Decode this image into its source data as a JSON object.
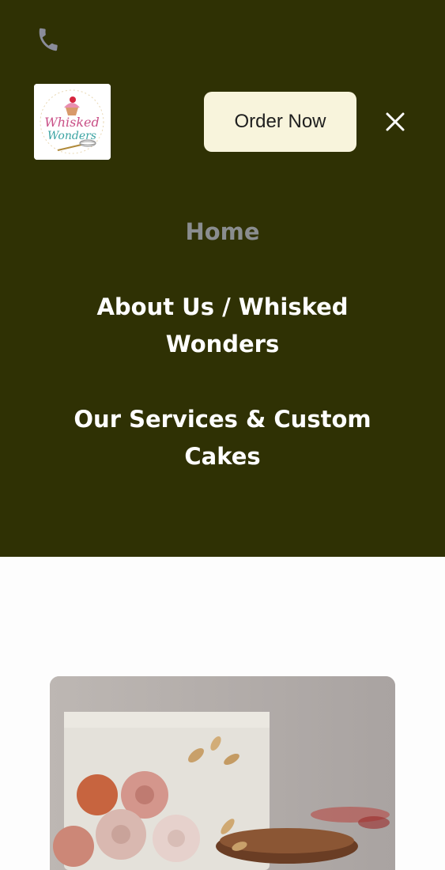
{
  "header": {
    "phone_icon": "phone-icon",
    "logo": {
      "line1": "Whisked",
      "line2": "Wonders"
    },
    "order_button_label": "Order Now",
    "close_icon": "close-icon"
  },
  "nav": {
    "items": [
      {
        "label": "Home",
        "active": true
      },
      {
        "label": "About Us / Whisked Wonders",
        "active": false
      },
      {
        "label": "Our Services & Custom Cakes",
        "active": false
      }
    ]
  },
  "colors": {
    "menu_background": "#2f3104",
    "order_button_bg": "#f8f4dc",
    "active_nav": "#8a8d8f",
    "nav_text": "#ffffff"
  },
  "hero_image": {
    "icon": "cake-photo"
  }
}
